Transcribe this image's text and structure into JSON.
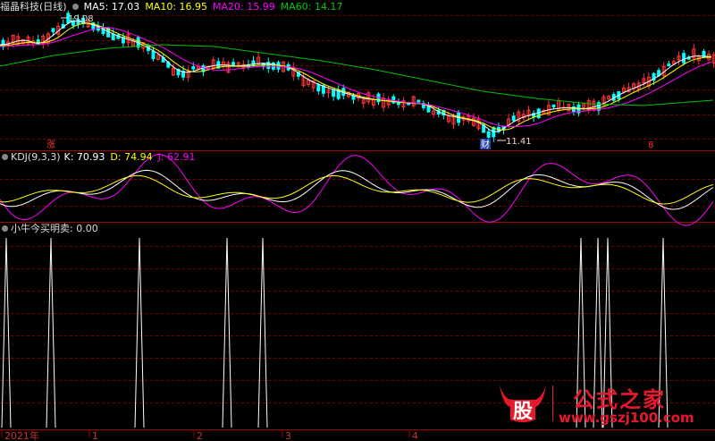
{
  "main_legend": {
    "title": "福晶科技(日线)",
    "ma5": "MA5: 17.03",
    "ma10": "MA10: 16.95",
    "ma20": "MA20: 15.99",
    "ma60": "MA60: 14.17"
  },
  "price_annotations": {
    "high": "19.08",
    "low": "11.41"
  },
  "markers": {
    "zhang": "涨",
    "cai": "财",
    "ba": "8"
  },
  "kdj_legend": {
    "name": "KDJ(9,3,3)",
    "k": "K: 70.93",
    "d": "D: 74.94",
    "j": "J: 62.91"
  },
  "signal_legend": {
    "name": "小牛今买明卖",
    "value": ": 0.00"
  },
  "xaxis": {
    "labels": [
      "2021年",
      "1",
      "2",
      "3",
      "4"
    ]
  },
  "colors": {
    "ma5": "#ffffff",
    "ma10": "#ffff00",
    "ma20": "#ff00ff",
    "ma60": "#00c000",
    "up": "#ff3333",
    "down": "#00ffff",
    "grid": "#800000",
    "axis": "#a00000"
  },
  "watermark": {
    "logo": "股",
    "title": "公式之家",
    "url": "www.gszj100.com"
  }
}
